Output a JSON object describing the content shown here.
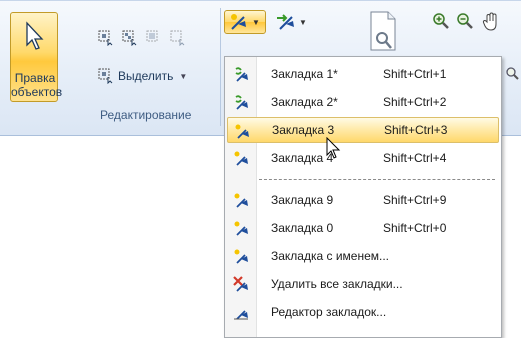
{
  "ribbon": {
    "edit_objects_label_line1": "Правка",
    "edit_objects_label_line2": "объектов",
    "select_label": "Выделить",
    "group_label": "Редактирование"
  },
  "menu": {
    "items": [
      {
        "label": "Закладка 1*",
        "shortcut": "Shift+Ctrl+1",
        "icon": "bookmark-set-icon"
      },
      {
        "label": "Закладка 2*",
        "shortcut": "Shift+Ctrl+2",
        "icon": "bookmark-set-icon"
      },
      {
        "label": "Закладка 3",
        "shortcut": "Shift+Ctrl+3",
        "icon": "bookmark-icon",
        "hover": true
      },
      {
        "label": "Закладка 4",
        "shortcut": "Shift+Ctrl+4",
        "icon": "bookmark-icon"
      },
      {
        "label": "Закладка 9",
        "shortcut": "Shift+Ctrl+9",
        "icon": "bookmark-icon"
      },
      {
        "label": "Закладка 0",
        "shortcut": "Shift+Ctrl+0",
        "icon": "bookmark-icon"
      },
      {
        "label": "Закладка с именем...",
        "shortcut": "",
        "icon": "bookmark-named-icon"
      },
      {
        "label": "Удалить все закладки...",
        "shortcut": "",
        "icon": "delete-bookmarks-icon"
      },
      {
        "label": "Редактор закладок...",
        "shortcut": "",
        "icon": "bookmark-editor-icon"
      }
    ]
  },
  "colors": {
    "ribbon_bg": "#dbe6f4",
    "hover_bg": "#ffe9a6",
    "accent_blue": "#1f4e9c",
    "accent_green": "#3a9a2a",
    "accent_red": "#d23a2a"
  }
}
